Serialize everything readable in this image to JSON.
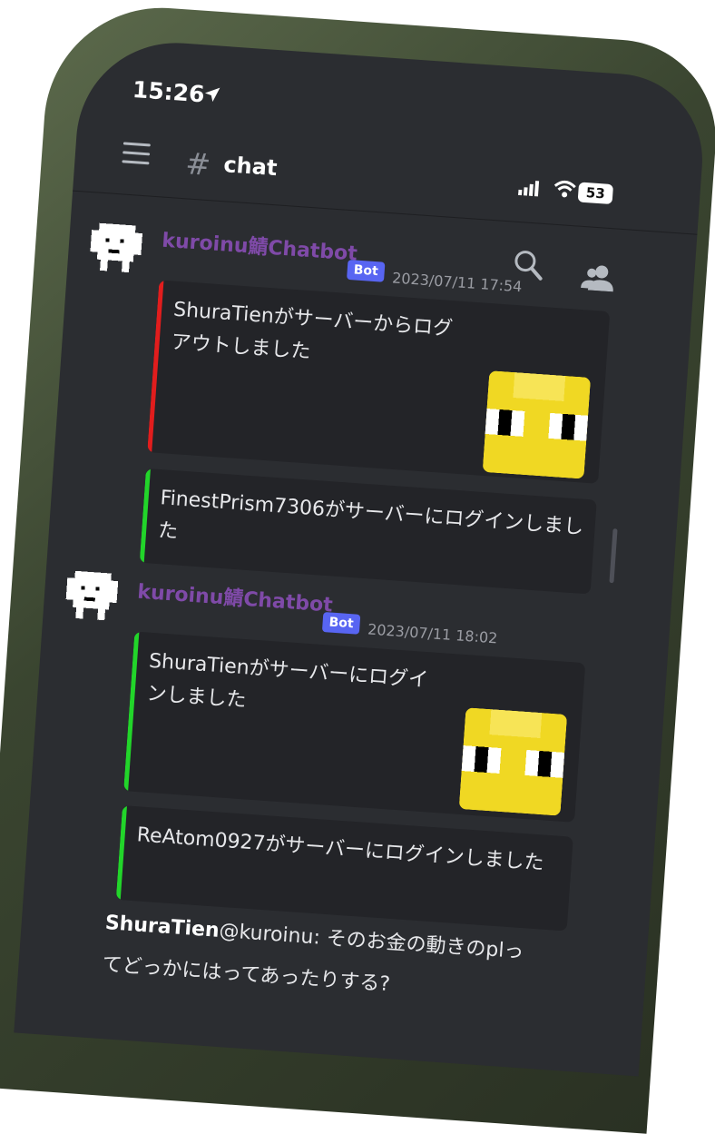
{
  "status": {
    "time": "15:26",
    "battery": "53"
  },
  "header": {
    "channel_hash": "#",
    "channel_name": "chat"
  },
  "messages": [
    {
      "author": "kuroinu鯖Chatbot",
      "badge": "Bot",
      "timestamp": "2023/07/11 17:54",
      "embeds": [
        {
          "text": "ShuraTienがサーバーからログアウトしました",
          "color": "#e11d1d",
          "has_thumb": true
        },
        {
          "text": "FinestPrism7306がサーバーにログインしました",
          "color": "#22d52a",
          "has_thumb": false
        }
      ]
    },
    {
      "author": "kuroinu鯖Chatbot",
      "badge": "Bot",
      "timestamp": "2023/07/11 18:02",
      "embeds": [
        {
          "text": "ShuraTienがサーバーにログインしました",
          "color": "#22d52a",
          "has_thumb": true
        },
        {
          "text": "ReAtom0927がサーバーにログインしました",
          "color": "#22d52a",
          "has_thumb": false
        }
      ]
    }
  ],
  "chat_message": {
    "author": "ShuraTien",
    "mention": "@kuroinu",
    "line1": ": そのお金の動きのplっ",
    "line2": "てどっかにはってあったりする?"
  },
  "colors": {
    "screen_bg": "#2b2d31",
    "embed_bg": "#232428",
    "username": "#7f4aa8",
    "bot_badge": "#5865f2"
  },
  "icons": [
    "location-arrow-icon",
    "menu-icon",
    "hash-icon",
    "signal-icon",
    "wifi-icon",
    "search-icon",
    "members-icon",
    "dog-avatar-icon",
    "yellow-face-thumbnail"
  ]
}
